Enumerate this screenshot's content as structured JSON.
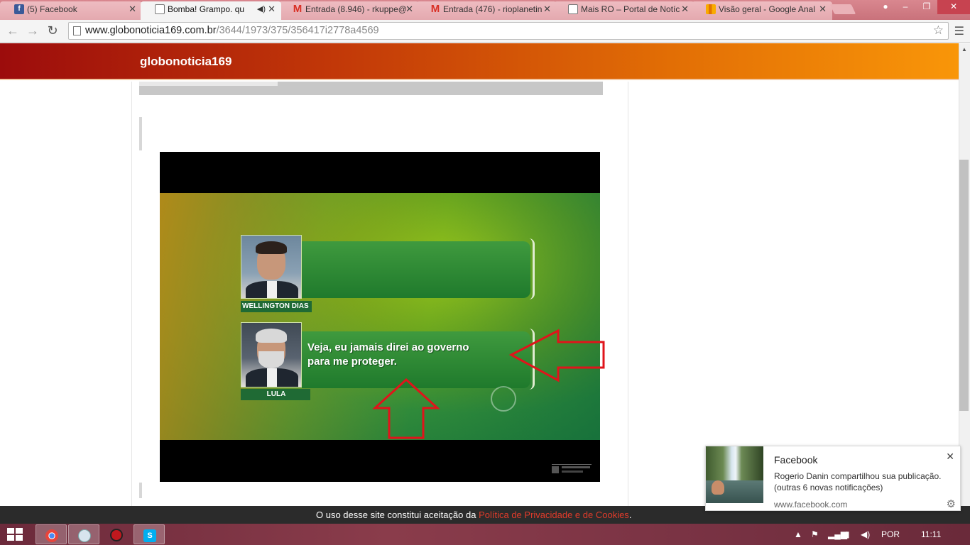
{
  "browser": {
    "tabs": [
      {
        "label": "(5) Facebook",
        "icon": "facebook-icon"
      },
      {
        "label": "Bomba!  Grampo.  qu",
        "icon": "page-icon",
        "active": true,
        "audio": true
      },
      {
        "label": "Entrada (8.946) - rkuppe@",
        "icon": "gmail-icon"
      },
      {
        "label": "Entrada (476) - rioplanetin",
        "icon": "gmail-icon"
      },
      {
        "label": "Mais RO – Portal de Notíc",
        "icon": "page-icon"
      },
      {
        "label": "Visão geral - Google Anal",
        "icon": "analytics-icon"
      }
    ],
    "url_host": "www.globonoticia169.com.br",
    "url_path": "/3644/1973/375/356417i2778a4569"
  },
  "site": {
    "title": "globonoticia169"
  },
  "video": {
    "speakers": [
      {
        "name": "WELLINGTON DIAS",
        "quote": ""
      },
      {
        "name": "LULA",
        "quote_line1": "Veja, eu jamais direi ao governo",
        "quote_line2": "para me proteger."
      }
    ]
  },
  "cookie_bar": {
    "text": "O uso desse site constitui aceitação da ",
    "link": "Política de Privacidade e de Cookies",
    "end": "."
  },
  "notification": {
    "title": "Facebook",
    "line1": "Rogerio Danin compartilhou sua publicação.",
    "line2": "(outras 6 novas notificações)",
    "source": "www.facebook.com"
  },
  "taskbar": {
    "language": "POR",
    "time": "11:11"
  },
  "colors": {
    "header_start": "#9c0c0c",
    "header_end": "#f99608",
    "arrow": "#e0141b",
    "cookie_link": "#e03b2b"
  }
}
